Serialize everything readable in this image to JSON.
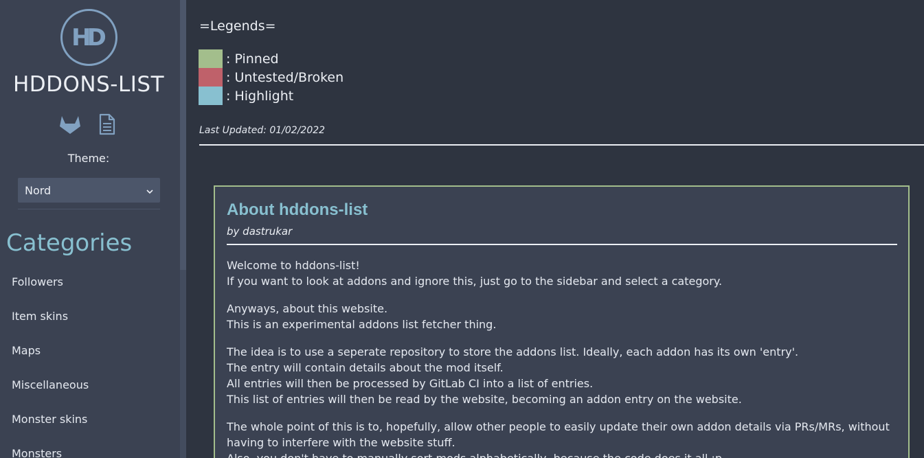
{
  "sidebar": {
    "logo_text": "HD",
    "site_title": "HDDONS-LIST",
    "icons": [
      "gitlab-icon",
      "document-icon"
    ],
    "theme_label": "Theme:",
    "theme_value": "Nord",
    "categories_heading": "Categories",
    "categories": [
      "Followers",
      "Item skins",
      "Maps",
      "Miscellaneous",
      "Monster skins",
      "Monsters"
    ]
  },
  "legend": {
    "title": "=Legends=",
    "items": [
      {
        "label": ": Pinned",
        "color": "#a3be8c"
      },
      {
        "label": ": Untested/Broken",
        "color": "#bf616a"
      },
      {
        "label": ": Highlight",
        "color": "#88c0d0"
      }
    ],
    "last_updated": "Last Updated: 01/02/2022"
  },
  "card": {
    "title": "About hddons-list",
    "author": "by dastrukar",
    "paragraphs": [
      [
        "Welcome to hddons-list!",
        "If you want to look at addons and ignore this, just go to the sidebar and select a category."
      ],
      [
        "Anyways, about this website.",
        "This is an experimental addons list fetcher thing."
      ],
      [
        "The idea is to use a seperate repository to store the addons list. Ideally, each addon has its own 'entry'.",
        "The entry will contain details about the mod itself.",
        "All entries will then be processed by GitLab CI into a list of entries.",
        "This list of entries will then be read by the website, becoming an addon entry on the website."
      ],
      [
        "The whole point of this is to, hopefully, allow other people to easily update their own addon details via PRs/MRs, without having to interfere with the website stuff.",
        "Also, you don't have to manually sort mods alphabetically, because the code does it all :p"
      ]
    ]
  },
  "colors": {
    "background": "#2e3440",
    "sidebar": "#3b4252",
    "accent": "#88c0d0",
    "card_border": "#a3be8c"
  }
}
